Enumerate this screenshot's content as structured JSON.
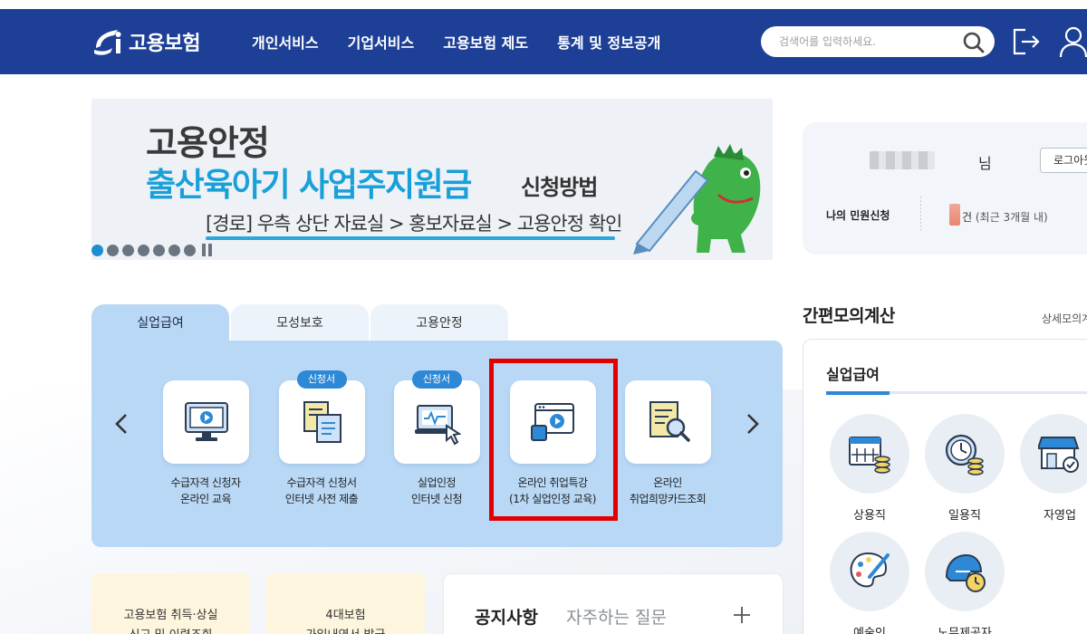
{
  "header": {
    "logo_text": "고용보험",
    "nav": [
      "개인서비스",
      "기업서비스",
      "고용보험 제도",
      "통계 및 정보공개"
    ],
    "search_placeholder": "검색어를 입력하세요.",
    "icons": [
      "search-icon",
      "logout-icon",
      "user-icon"
    ],
    "colors": {
      "bar": "#1d3f96"
    }
  },
  "banner": {
    "title": "고용안정",
    "subtitle": "출산육아기 사업주지원금",
    "subtitle_small": "신청방법",
    "route": "[경로] 우측 상단 자료실 > 홍보자료실 > 고용안정 확인",
    "slide_count": 7,
    "active_slide": 1,
    "accent": "#1aa0d8"
  },
  "login": {
    "suffix": "님",
    "login_button": "로그아웃",
    "my_requests_label": "나의 민원신청",
    "count_unit": "건",
    "period": "(최근 3개월 내)"
  },
  "tabs": [
    "실업급여",
    "모성보호",
    "고용안정"
  ],
  "services": [
    {
      "badge": "",
      "line1": "수급자격 신청자",
      "line2": "온라인 교육",
      "icon": "monitor-play-icon"
    },
    {
      "badge": "신청서",
      "line1": "수급자격 신청서",
      "line2": "인터넷 사전 제출",
      "icon": "document-form-icon"
    },
    {
      "badge": "신청서",
      "line1": "실업인정",
      "line2": "인터넷 신청",
      "icon": "laptop-click-icon"
    },
    {
      "badge": "",
      "line1": "온라인 취업특강",
      "line2": "(1차 실업인정 교육)",
      "icon": "video-window-icon"
    },
    {
      "badge": "",
      "line1": "온라인",
      "line2": "취업희망카드조회",
      "icon": "doc-search-icon"
    }
  ],
  "calculator": {
    "title": "간편모의계산",
    "more": "상세모의계산",
    "tab": "실업급여",
    "items": [
      {
        "label": "상용직",
        "icon": "calendar-coins-icon"
      },
      {
        "label": "일용직",
        "icon": "clock-coins-icon"
      },
      {
        "label": "자영업",
        "icon": "store-icon"
      },
      {
        "label": "예술인",
        "icon": "palette-icon"
      },
      {
        "label": "노무제공자",
        "icon": "helmet-clock-icon"
      }
    ]
  },
  "bottom": {
    "card1_line1": "고용보험 취득·상실",
    "card1_line2": "신고 및 이력조회",
    "card2_line1": "4대보험",
    "card2_line2": "가입내역서 발급",
    "notice_tab": "공지사항",
    "faq_tab": "자주하는 질문"
  }
}
